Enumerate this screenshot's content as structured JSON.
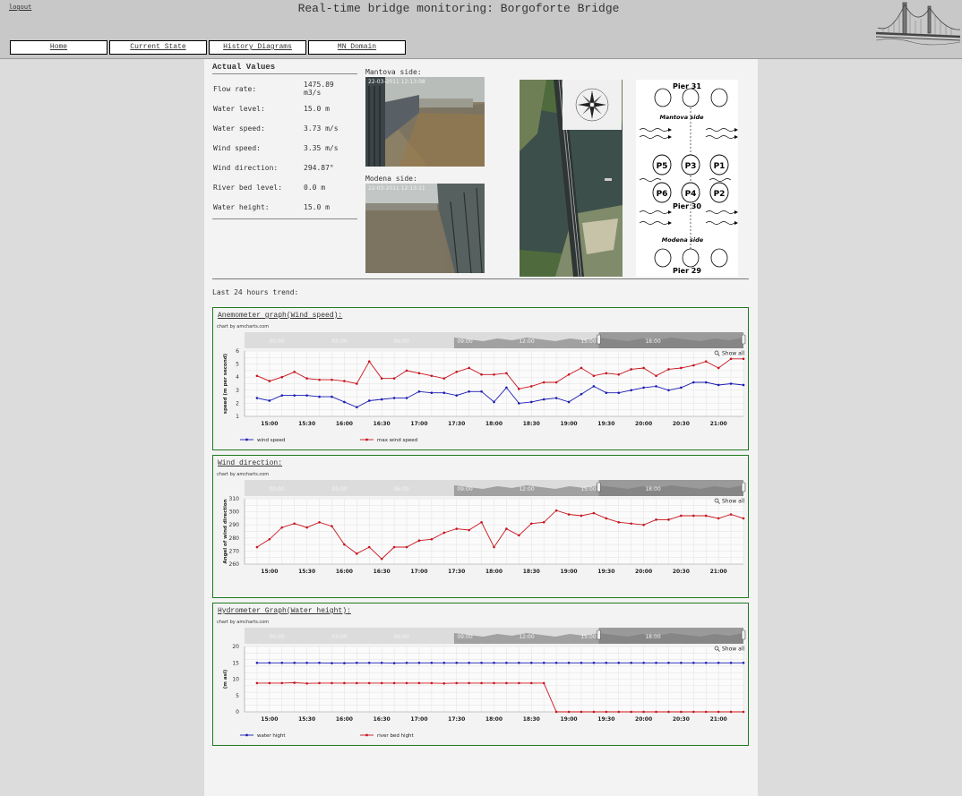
{
  "header": {
    "title": "Real-time bridge monitoring: Borgoforte Bridge",
    "logout": "logout",
    "nav": [
      "Home",
      "Current State",
      "History Diagrams",
      "MN Domain"
    ]
  },
  "actual_values": {
    "title": "Actual Values",
    "rows": [
      {
        "label": "Flow rate:",
        "value": "1475.89 m3/s"
      },
      {
        "label": "Water level:",
        "value": "15.0 m"
      },
      {
        "label": "Water speed:",
        "value": "3.73 m/s"
      },
      {
        "label": "Wind speed:",
        "value": "3.35 m/s"
      },
      {
        "label": "Wind direction:",
        "value": "294.87°"
      },
      {
        "label": "River bed level:",
        "value": "0.0 m"
      },
      {
        "label": "Water height:",
        "value": "15.0 m"
      }
    ]
  },
  "cameras": {
    "mantova_label": "Mantova side:",
    "mantova_ts": "22-03-2011 12:13:08",
    "modena_label": "Modena side:",
    "modena_ts": "22-03-2011 12:13:11"
  },
  "piers": {
    "top": "Pier 31",
    "mid": "Pier 30",
    "bottom": "Pier 29",
    "mantova": "Mantova side",
    "modena": "Modena side",
    "labels": [
      "P5",
      "P3",
      "P1",
      "P6",
      "P4",
      "P2"
    ]
  },
  "trend_title": "Last 24 hours trend:",
  "scroller_labels": [
    "00:00",
    "03:00",
    "06:00",
    "09:00",
    "12:00",
    "15:00",
    "18:00"
  ],
  "x_tick_labels": [
    "15:00",
    "15:30",
    "16:00",
    "16:30",
    "17:00",
    "17:30",
    "18:00",
    "18:30",
    "19:00",
    "19:30",
    "20:00",
    "20:30",
    "21:00"
  ],
  "credit": "chart by amcharts.com",
  "show_all": "Show all",
  "colors": {
    "blue": "#1c1cb4",
    "red": "#c8141e",
    "border": "#1f7a1f"
  },
  "chart_data": [
    {
      "type": "line",
      "title": "Anemometer graph(Wind speed):",
      "ylabel": "speed (m per second)",
      "ylim": [
        1,
        6
      ],
      "yticks": [
        1,
        2,
        3,
        4,
        5,
        6
      ],
      "xlim": [
        "14:40",
        "21:20"
      ],
      "legend": "bottom-left",
      "series": [
        {
          "name": "wind speed",
          "color": "#1c1cb4",
          "x": [
            "14:50",
            "15:00",
            "15:10",
            "15:20",
            "15:30",
            "15:40",
            "15:50",
            "16:00",
            "16:10",
            "16:20",
            "16:30",
            "16:40",
            "16:50",
            "17:00",
            "17:10",
            "17:20",
            "17:30",
            "17:40",
            "17:50",
            "18:00",
            "18:10",
            "18:20",
            "18:30",
            "18:40",
            "18:50",
            "19:00",
            "19:10",
            "19:20",
            "19:30",
            "19:40",
            "19:50",
            "20:00",
            "20:10",
            "20:20",
            "20:30",
            "20:40",
            "20:50",
            "21:00",
            "21:10",
            "21:20"
          ],
          "values": [
            2.4,
            2.2,
            2.6,
            2.6,
            2.6,
            2.5,
            2.5,
            2.1,
            1.7,
            2.2,
            2.3,
            2.4,
            2.4,
            2.9,
            2.8,
            2.8,
            2.6,
            2.9,
            2.9,
            2.1,
            3.2,
            2.0,
            2.1,
            2.3,
            2.4,
            2.1,
            2.7,
            3.3,
            2.8,
            2.8,
            3.0,
            3.2,
            3.3,
            3.0,
            3.2,
            3.6,
            3.6,
            3.4,
            3.5,
            3.4
          ]
        },
        {
          "name": "max wind speed",
          "color": "#c8141e",
          "x": [
            "14:50",
            "15:00",
            "15:10",
            "15:20",
            "15:30",
            "15:40",
            "15:50",
            "16:00",
            "16:10",
            "16:20",
            "16:30",
            "16:40",
            "16:50",
            "17:00",
            "17:10",
            "17:20",
            "17:30",
            "17:40",
            "17:50",
            "18:00",
            "18:10",
            "18:20",
            "18:30",
            "18:40",
            "18:50",
            "19:00",
            "19:10",
            "19:20",
            "19:30",
            "19:40",
            "19:50",
            "20:00",
            "20:10",
            "20:20",
            "20:30",
            "20:40",
            "20:50",
            "21:00",
            "21:10",
            "21:20"
          ],
          "values": [
            4.1,
            3.7,
            4.0,
            4.4,
            3.9,
            3.8,
            3.8,
            3.7,
            3.5,
            5.2,
            3.9,
            3.9,
            4.5,
            4.3,
            4.1,
            3.9,
            4.4,
            4.7,
            4.2,
            4.2,
            4.3,
            3.1,
            3.3,
            3.6,
            3.6,
            4.2,
            4.7,
            4.1,
            4.3,
            4.2,
            4.6,
            4.7,
            4.1,
            4.6,
            4.7,
            4.9,
            5.2,
            4.7,
            5.4,
            5.4
          ]
        }
      ]
    },
    {
      "type": "line",
      "title": "Wind direction:",
      "ylabel": "Angel of wind direction",
      "ylim": [
        260,
        310
      ],
      "yticks": [
        260,
        270,
        280,
        290,
        300,
        310
      ],
      "xlim": [
        "14:40",
        "21:20"
      ],
      "series": [
        {
          "name": "",
          "color": "#c8141e",
          "x": [
            "14:50",
            "15:00",
            "15:10",
            "15:20",
            "15:30",
            "15:40",
            "15:50",
            "16:00",
            "16:10",
            "16:20",
            "16:30",
            "16:40",
            "16:50",
            "17:00",
            "17:10",
            "17:20",
            "17:30",
            "17:40",
            "17:50",
            "18:00",
            "18:10",
            "18:20",
            "18:30",
            "18:40",
            "18:50",
            "19:00",
            "19:10",
            "19:20",
            "19:30",
            "19:40",
            "19:50",
            "20:00",
            "20:10",
            "20:20",
            "20:30",
            "20:40",
            "20:50",
            "21:00",
            "21:10",
            "21:20"
          ],
          "values": [
            273,
            279,
            288,
            291,
            288,
            292,
            289,
            275,
            268,
            273,
            264,
            273,
            273,
            278,
            279,
            284,
            287,
            286,
            292,
            273,
            287,
            282,
            291,
            292,
            301,
            298,
            297,
            299,
            295,
            292,
            291,
            290,
            294,
            294,
            297,
            297,
            297,
            295,
            298,
            295
          ]
        }
      ]
    },
    {
      "type": "line",
      "title": "Hydrometer Graph(Water height):",
      "ylabel": "(m asl)",
      "ylim": [
        0,
        20
      ],
      "yticks": [
        0,
        5,
        10,
        15,
        20
      ],
      "xlim": [
        "14:40",
        "21:20"
      ],
      "legend": "bottom-left",
      "series": [
        {
          "name": "water hight",
          "color": "#1c1cb4",
          "x": [
            "14:50",
            "15:00",
            "15:10",
            "15:20",
            "15:30",
            "15:40",
            "15:50",
            "16:00",
            "16:10",
            "16:20",
            "16:30",
            "16:40",
            "16:50",
            "17:00",
            "17:10",
            "17:20",
            "17:30",
            "17:40",
            "17:50",
            "18:00",
            "18:10",
            "18:20",
            "18:30",
            "18:40",
            "18:50",
            "19:00",
            "19:10",
            "19:20",
            "19:30",
            "19:40",
            "19:50",
            "20:00",
            "20:10",
            "20:20",
            "20:30",
            "20:40",
            "20:50",
            "21:00",
            "21:10",
            "21:20"
          ],
          "values": [
            15,
            15,
            15,
            15,
            15,
            15,
            14.9,
            14.9,
            15,
            15,
            15,
            14.9,
            15,
            15,
            15,
            15,
            15,
            15,
            15,
            15,
            15,
            15,
            15,
            15,
            15,
            15,
            15,
            15,
            15,
            15,
            15,
            15,
            15,
            15,
            15,
            15,
            15,
            15,
            15,
            15
          ]
        },
        {
          "name": "river bed hight",
          "color": "#c8141e",
          "x": [
            "14:50",
            "15:00",
            "15:10",
            "15:20",
            "15:30",
            "15:40",
            "15:50",
            "16:00",
            "16:10",
            "16:20",
            "16:30",
            "16:40",
            "16:50",
            "17:00",
            "17:10",
            "17:20",
            "17:30",
            "17:40",
            "17:50",
            "18:00",
            "18:10",
            "18:20",
            "18:30",
            "18:40",
            "18:50",
            "19:00",
            "19:10",
            "19:20",
            "19:30",
            "19:40",
            "19:50",
            "20:00",
            "20:10",
            "20:20",
            "20:30",
            "20:40",
            "20:50",
            "21:00",
            "21:10",
            "21:20"
          ],
          "values": [
            8.8,
            8.8,
            8.8,
            8.9,
            8.7,
            8.8,
            8.8,
            8.8,
            8.8,
            8.8,
            8.8,
            8.8,
            8.8,
            8.8,
            8.8,
            8.7,
            8.8,
            8.8,
            8.8,
            8.8,
            8.8,
            8.8,
            8.8,
            8.8,
            0,
            0,
            0,
            0,
            0,
            0,
            0,
            0,
            0,
            0,
            0,
            0,
            0,
            0,
            0,
            0
          ]
        }
      ]
    }
  ]
}
